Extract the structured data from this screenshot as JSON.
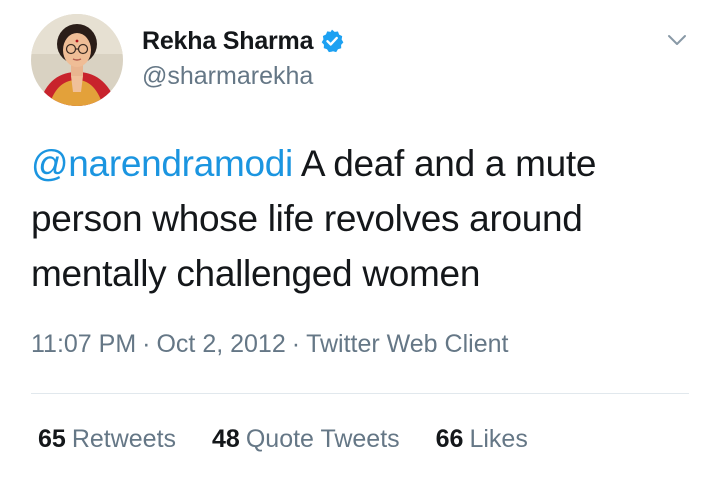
{
  "author": {
    "name": "Rekha Sharma",
    "handle": "@sharmarekha",
    "verified_icon": "verified-badge-icon",
    "avatar_icon": "profile-photo"
  },
  "menu_icon": "chevron-down-icon",
  "tweet": {
    "mention": "@narendramodi",
    "text": " A deaf and a mute person whose life revolves around mentally challenged women"
  },
  "meta": {
    "time": "11:07 PM",
    "separator": "·",
    "date": "Oct 2, 2012",
    "client": "Twitter Web Client"
  },
  "stats": [
    {
      "count": "65",
      "label": "Retweets"
    },
    {
      "count": "48",
      "label": "Quote Tweets"
    },
    {
      "count": "66",
      "label": "Likes"
    }
  ],
  "colors": {
    "text": "#14171a",
    "secondary": "#657786",
    "link": "#1b95e0",
    "divider": "#e1e8ed"
  }
}
